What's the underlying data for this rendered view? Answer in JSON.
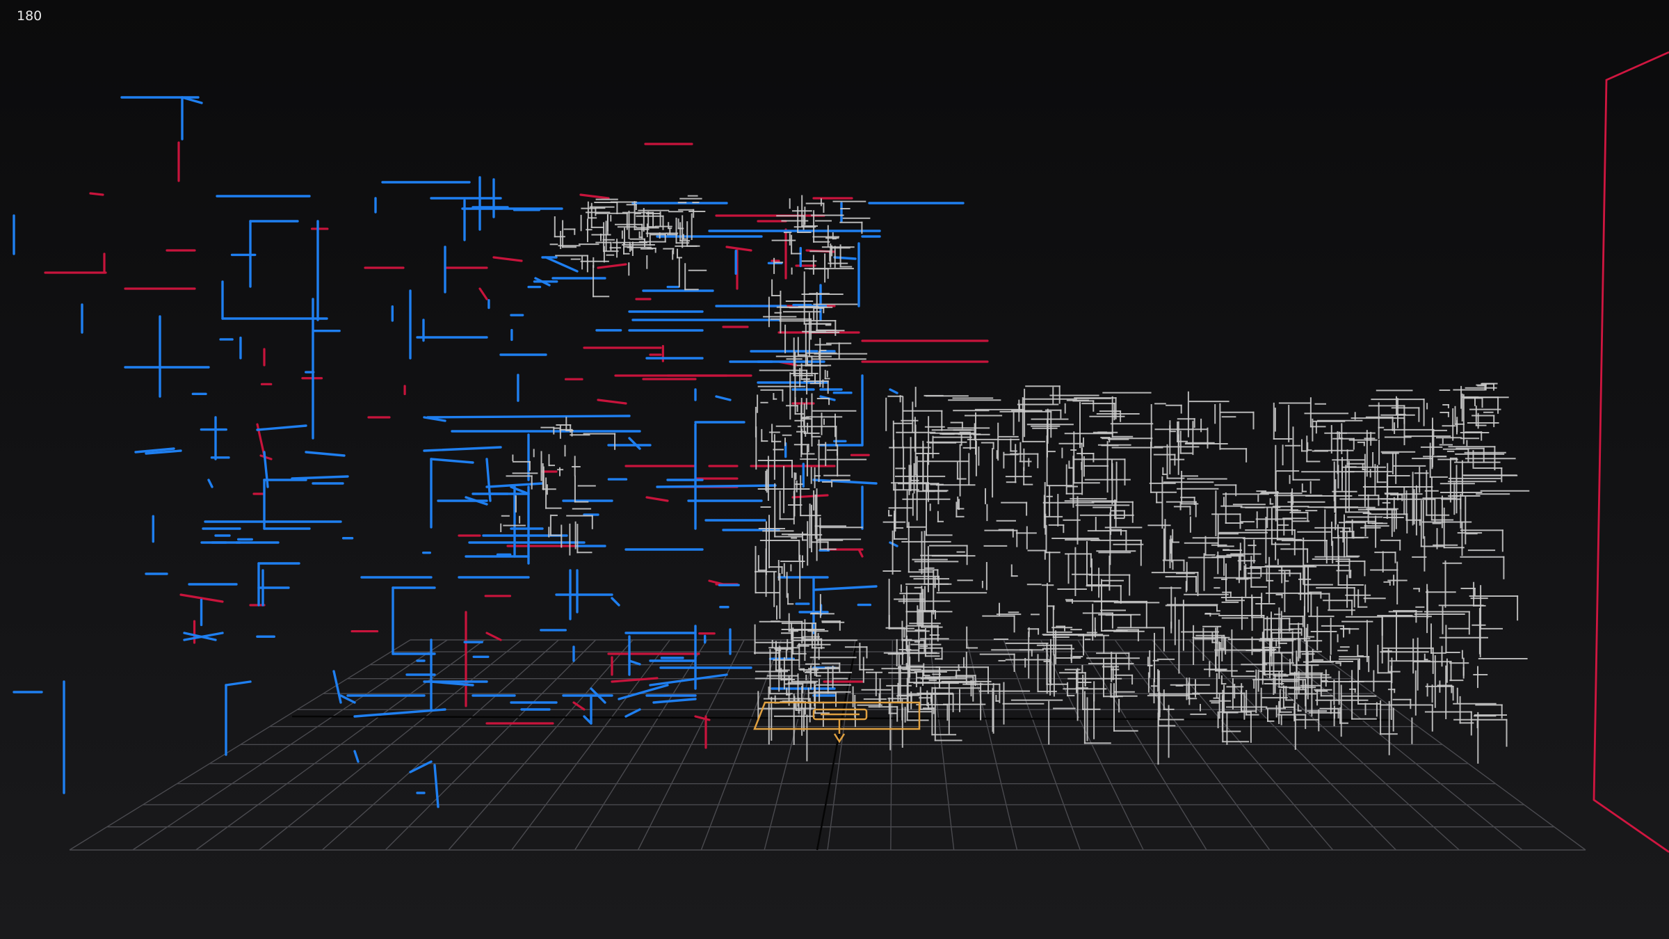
{
  "hud": {
    "frame_counter": "180"
  },
  "scene": {
    "colors": {
      "background": "#0b0b0c",
      "grid": "#4a4a4f",
      "blue_segments": "#1f7ff0",
      "red_segments": "#c8143c",
      "white_segments": "#c9c9c9",
      "camera_frustum": "#e0a040",
      "boundary": "#d01640"
    },
    "elements": [
      "grid-floor",
      "line-segments-blue",
      "line-segments-red",
      "line-segments-white",
      "camera-frustum",
      "boundary-frame"
    ]
  }
}
